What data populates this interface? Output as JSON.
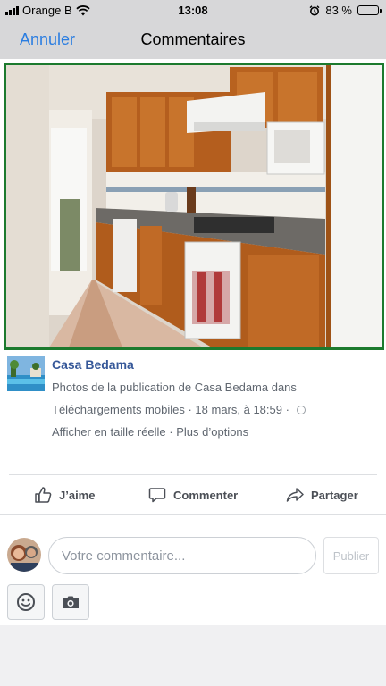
{
  "status_bar": {
    "carrier": "Orange B",
    "time": "13:08",
    "battery_text": "83 %",
    "battery_level": 0.83,
    "icons": [
      "signal-icon",
      "wifi-icon",
      "alarm-icon",
      "battery-icon"
    ]
  },
  "nav": {
    "cancel_label": "Annuler",
    "title": "Commentaires"
  },
  "post": {
    "photo_alt": "Cuisine",
    "author": "Casa Bedama",
    "caption": "Photos de la publication de Casa Bedama dans",
    "album": "Téléchargements mobiles",
    "date": " · 18 mars, à 18:59 · ",
    "links": "Afficher en taille réelle · Plus d’options"
  },
  "actions": {
    "like": "J’aime",
    "comment": "Commenter",
    "share": "Partager"
  },
  "composer": {
    "placeholder": "Votre commentaire...",
    "publish_label": "Publier"
  },
  "colors": {
    "link": "#365899",
    "accent": "#2a7de1",
    "photo_border": "#1c7a2e"
  }
}
